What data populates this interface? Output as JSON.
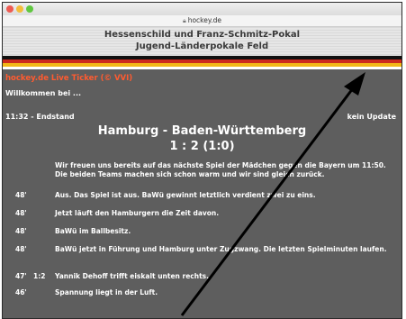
{
  "browser": {
    "url": "hockey.de"
  },
  "header": {
    "line1": "Hessenschild und Franz-Schmitz-Pokal",
    "line2": "Jugend-Länderpokale Feld"
  },
  "ticker": {
    "title": "hockey.de Live Ticker (© VVI)",
    "welcome": "Willkommen bei ...",
    "status_time": "11:32 - Endstand",
    "status_update": "kein Update",
    "match_title": "Hamburg - Baden-Württemberg",
    "match_score": "1 : 2  (1:0)",
    "intro": "Wir freuen uns bereits auf das nächste Spiel der Mädchen gegen die Bayern um 11:50. Die beiden Teams machen sich schon warm und wir sind gleich zurück.",
    "entries": [
      {
        "minute": "48'",
        "score": "",
        "text": "Aus. Das Spiel ist aus. BaWü gewinnt letztlich verdient zwei zu eins."
      },
      {
        "minute": "48'",
        "score": "",
        "text": "Jetzt läuft den Hamburgern die Zeit davon."
      },
      {
        "minute": "48'",
        "score": "",
        "text": "BaWü im Ballbesitz."
      },
      {
        "minute": "48'",
        "score": "",
        "text": "BaWü jetzt in Führung und Hamburg unter Zugzwang. Die letzten Spielminuten laufen."
      },
      {
        "minute": "47'",
        "score": "1:2",
        "text": "Yannik Dehoff trifft eiskalt unten rechts."
      },
      {
        "minute": "46'",
        "score": "",
        "text": "Spannung liegt in der Luft."
      }
    ]
  },
  "colors": {
    "background": "#5e5e5e",
    "accent": "#ff5b30",
    "flag": [
      "#111111",
      "#cc2a1e",
      "#f2b818"
    ]
  }
}
